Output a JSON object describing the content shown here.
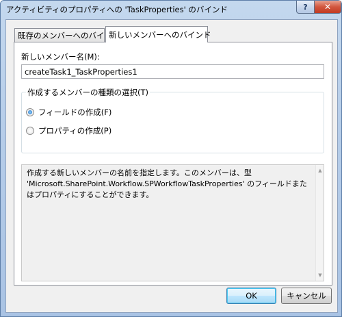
{
  "window": {
    "title": "アクティビティのプロパティへの 'TaskProperties' のバインド",
    "help_glyph": "?",
    "close_glyph": "✕"
  },
  "tabs": [
    {
      "label": "既存のメンバーへのバインド",
      "selected": false
    },
    {
      "label": "新しいメンバーへのバインド",
      "selected": true
    }
  ],
  "form": {
    "member_name_label": "新しいメンバー名(M):",
    "member_name_value": "createTask1_TaskProperties1",
    "member_type_group_label": "作成するメンバーの種類の選択(T)",
    "options": [
      {
        "label": "フィールドの作成(F)",
        "checked": true
      },
      {
        "label": "プロパティの作成(P)",
        "checked": false
      }
    ],
    "description": "作成する新しいメンバーの名前を指定します。このメンバーは、型 'Microsoft.SharePoint.Workflow.SPWorkflowTaskProperties' のフィールドまたはプロパティにすることができます。"
  },
  "buttons": {
    "ok": "OK",
    "cancel": "キャンセル"
  },
  "colors": {
    "title_bar": "#b6cde9",
    "close_button": "#c23a22",
    "panel_background": "#f0f0f0"
  }
}
